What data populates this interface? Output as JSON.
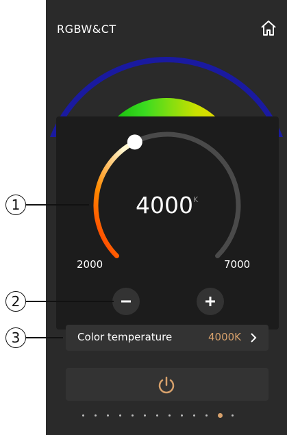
{
  "header": {
    "title": "RGBW&CT",
    "home_icon": "home-icon"
  },
  "color_temperature_popup": {
    "value": "4000",
    "unit": "K",
    "min_label": "2000",
    "max_label": "7000",
    "min": 2000,
    "max": 7000,
    "current": 4000,
    "decrease_icon": "minus-icon",
    "increase_icon": "plus-icon"
  },
  "settings_row": {
    "label": "Color temperature",
    "value": "4000K",
    "chevron_icon": "chevron-right-icon"
  },
  "power": {
    "icon": "power-icon"
  },
  "pager": {
    "count": 13,
    "active_index": 11
  },
  "callouts": [
    "1",
    "2",
    "3"
  ],
  "colors": {
    "panel_bg": "#2a2a2a",
    "popup_bg": "#1c1c1c",
    "button_bg": "#333333",
    "accent": "#d7a16c",
    "track": "#4a4a4a"
  }
}
